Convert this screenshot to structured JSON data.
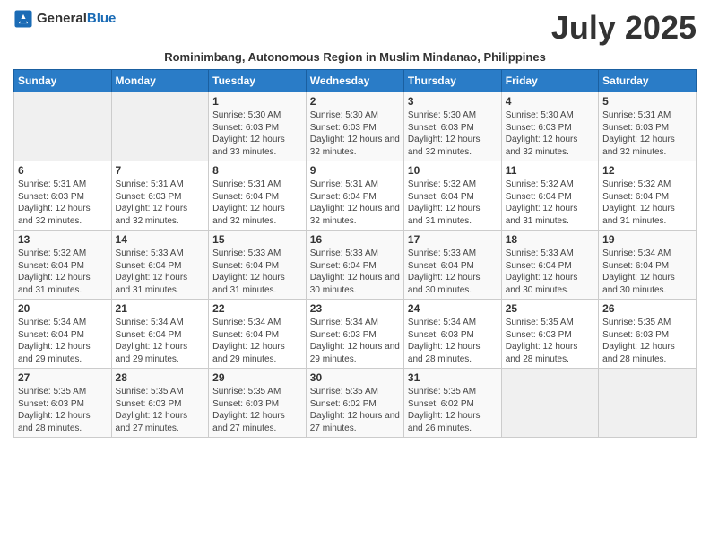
{
  "header": {
    "logo_general": "General",
    "logo_blue": "Blue",
    "month_title": "July 2025",
    "subtitle": "Rominimbang, Autonomous Region in Muslim Mindanao, Philippines"
  },
  "days_of_week": [
    "Sunday",
    "Monday",
    "Tuesday",
    "Wednesday",
    "Thursday",
    "Friday",
    "Saturday"
  ],
  "weeks": [
    [
      {
        "day": "",
        "detail": ""
      },
      {
        "day": "",
        "detail": ""
      },
      {
        "day": "1",
        "detail": "Sunrise: 5:30 AM\nSunset: 6:03 PM\nDaylight: 12 hours and 33 minutes."
      },
      {
        "day": "2",
        "detail": "Sunrise: 5:30 AM\nSunset: 6:03 PM\nDaylight: 12 hours and 32 minutes."
      },
      {
        "day": "3",
        "detail": "Sunrise: 5:30 AM\nSunset: 6:03 PM\nDaylight: 12 hours and 32 minutes."
      },
      {
        "day": "4",
        "detail": "Sunrise: 5:30 AM\nSunset: 6:03 PM\nDaylight: 12 hours and 32 minutes."
      },
      {
        "day": "5",
        "detail": "Sunrise: 5:31 AM\nSunset: 6:03 PM\nDaylight: 12 hours and 32 minutes."
      }
    ],
    [
      {
        "day": "6",
        "detail": "Sunrise: 5:31 AM\nSunset: 6:03 PM\nDaylight: 12 hours and 32 minutes."
      },
      {
        "day": "7",
        "detail": "Sunrise: 5:31 AM\nSunset: 6:03 PM\nDaylight: 12 hours and 32 minutes."
      },
      {
        "day": "8",
        "detail": "Sunrise: 5:31 AM\nSunset: 6:04 PM\nDaylight: 12 hours and 32 minutes."
      },
      {
        "day": "9",
        "detail": "Sunrise: 5:31 AM\nSunset: 6:04 PM\nDaylight: 12 hours and 32 minutes."
      },
      {
        "day": "10",
        "detail": "Sunrise: 5:32 AM\nSunset: 6:04 PM\nDaylight: 12 hours and 31 minutes."
      },
      {
        "day": "11",
        "detail": "Sunrise: 5:32 AM\nSunset: 6:04 PM\nDaylight: 12 hours and 31 minutes."
      },
      {
        "day": "12",
        "detail": "Sunrise: 5:32 AM\nSunset: 6:04 PM\nDaylight: 12 hours and 31 minutes."
      }
    ],
    [
      {
        "day": "13",
        "detail": "Sunrise: 5:32 AM\nSunset: 6:04 PM\nDaylight: 12 hours and 31 minutes."
      },
      {
        "day": "14",
        "detail": "Sunrise: 5:33 AM\nSunset: 6:04 PM\nDaylight: 12 hours and 31 minutes."
      },
      {
        "day": "15",
        "detail": "Sunrise: 5:33 AM\nSunset: 6:04 PM\nDaylight: 12 hours and 31 minutes."
      },
      {
        "day": "16",
        "detail": "Sunrise: 5:33 AM\nSunset: 6:04 PM\nDaylight: 12 hours and 30 minutes."
      },
      {
        "day": "17",
        "detail": "Sunrise: 5:33 AM\nSunset: 6:04 PM\nDaylight: 12 hours and 30 minutes."
      },
      {
        "day": "18",
        "detail": "Sunrise: 5:33 AM\nSunset: 6:04 PM\nDaylight: 12 hours and 30 minutes."
      },
      {
        "day": "19",
        "detail": "Sunrise: 5:34 AM\nSunset: 6:04 PM\nDaylight: 12 hours and 30 minutes."
      }
    ],
    [
      {
        "day": "20",
        "detail": "Sunrise: 5:34 AM\nSunset: 6:04 PM\nDaylight: 12 hours and 29 minutes."
      },
      {
        "day": "21",
        "detail": "Sunrise: 5:34 AM\nSunset: 6:04 PM\nDaylight: 12 hours and 29 minutes."
      },
      {
        "day": "22",
        "detail": "Sunrise: 5:34 AM\nSunset: 6:04 PM\nDaylight: 12 hours and 29 minutes."
      },
      {
        "day": "23",
        "detail": "Sunrise: 5:34 AM\nSunset: 6:03 PM\nDaylight: 12 hours and 29 minutes."
      },
      {
        "day": "24",
        "detail": "Sunrise: 5:34 AM\nSunset: 6:03 PM\nDaylight: 12 hours and 28 minutes."
      },
      {
        "day": "25",
        "detail": "Sunrise: 5:35 AM\nSunset: 6:03 PM\nDaylight: 12 hours and 28 minutes."
      },
      {
        "day": "26",
        "detail": "Sunrise: 5:35 AM\nSunset: 6:03 PM\nDaylight: 12 hours and 28 minutes."
      }
    ],
    [
      {
        "day": "27",
        "detail": "Sunrise: 5:35 AM\nSunset: 6:03 PM\nDaylight: 12 hours and 28 minutes."
      },
      {
        "day": "28",
        "detail": "Sunrise: 5:35 AM\nSunset: 6:03 PM\nDaylight: 12 hours and 27 minutes."
      },
      {
        "day": "29",
        "detail": "Sunrise: 5:35 AM\nSunset: 6:03 PM\nDaylight: 12 hours and 27 minutes."
      },
      {
        "day": "30",
        "detail": "Sunrise: 5:35 AM\nSunset: 6:02 PM\nDaylight: 12 hours and 27 minutes."
      },
      {
        "day": "31",
        "detail": "Sunrise: 5:35 AM\nSunset: 6:02 PM\nDaylight: 12 hours and 26 minutes."
      },
      {
        "day": "",
        "detail": ""
      },
      {
        "day": "",
        "detail": ""
      }
    ]
  ]
}
